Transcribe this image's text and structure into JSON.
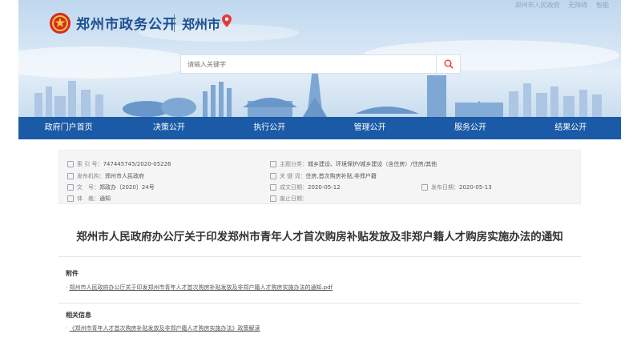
{
  "header": {
    "site_title": "郑州市政务公开",
    "city_name": "郑州市",
    "topnav": [
      "郑州市人民政府",
      "无障碍",
      "智能"
    ],
    "search_placeholder": "请输入关键字"
  },
  "nav": {
    "items": [
      "政府门户首页",
      "决策公开",
      "执行公开",
      "管理公开",
      "服务公开",
      "结果公开"
    ]
  },
  "meta": {
    "index_no": {
      "label": "索 引 号：",
      "value": "747445745/2020-05226"
    },
    "issuer": {
      "label": "发布机构：",
      "value": "郑州市人民政府"
    },
    "doc_no": {
      "label": "文　号：",
      "value": "郑政办〔2020〕24号"
    },
    "category": {
      "label": "体　裁：",
      "value": "通知"
    },
    "topic": {
      "label": "主题分类：",
      "value": "城乡建设、环境保护/城乡建设（含住房）/住房/其他"
    },
    "keywords": {
      "label": "关 键 词：",
      "value": "住房,首次购房补贴,非郑户籍"
    },
    "created": {
      "label": "成文日期：",
      "value": "2020-05-12"
    },
    "published": {
      "label": "发布日期：",
      "value": "2020-05-13"
    },
    "deadline": {
      "label": "废止日期：",
      "value": ""
    }
  },
  "article": {
    "title": "郑州市人民政府办公厅关于印发郑州市青年人才首次购房补贴发放及非郑户籍人才购房实施办法的通知",
    "attachment_head": "附件",
    "attachment_link": "郑州市人民政府办公厅关于印发郑州市青年人才首次购房补贴发放及非郑户籍人才购房实施办法的通知.pdf",
    "related_head": "相关信息",
    "related_link": "《郑州市青年人才首次购房补贴发放及非郑户籍人才购房实施办法》政策解读"
  }
}
